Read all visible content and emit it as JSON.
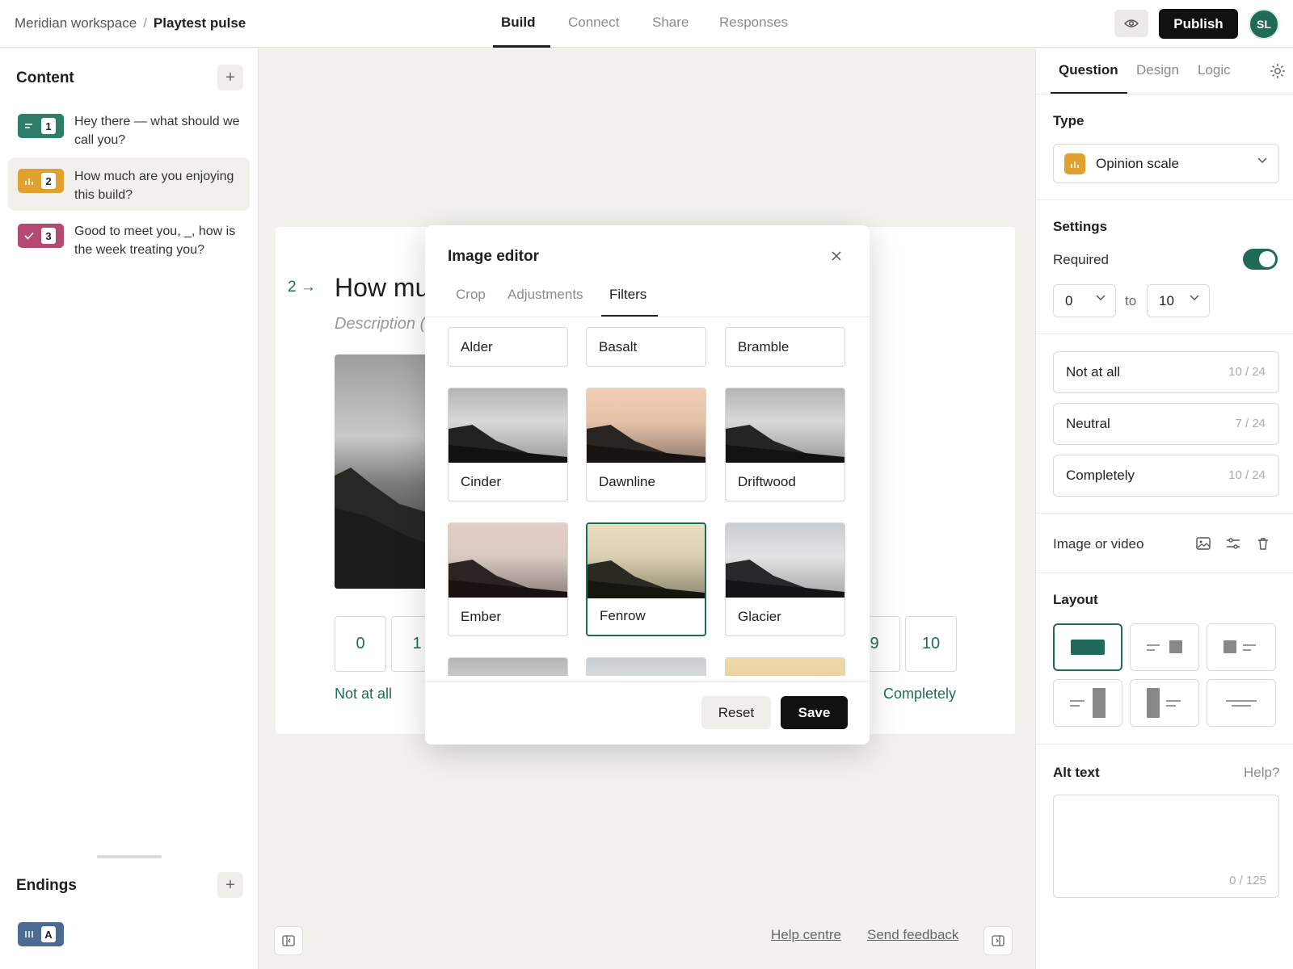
{
  "breadcrumb": {
    "workspace": "Meridian workspace",
    "separator": "/",
    "form": "Playtest pulse"
  },
  "nav_tabs": [
    "Build",
    "Connect",
    "Share",
    "Responses"
  ],
  "header": {
    "publish_label": "Publish",
    "avatar_initials": "SL"
  },
  "sidebar": {
    "content_heading": "Content",
    "questions": [
      {
        "num": "1",
        "text": "Hey there — what should we call you?",
        "color": "#2e7d68",
        "icon": "short-text-icon"
      },
      {
        "num": "2",
        "text": "How much are you enjoying this build?",
        "color": "#e0a12f",
        "icon": "bar-chart-icon"
      },
      {
        "num": "3",
        "text": "Good to meet you, _, how is the week treating you?",
        "color": "#b24a72",
        "icon": "check-icon"
      }
    ],
    "endings_heading": "Endings",
    "ending_badge": "A"
  },
  "canvas": {
    "question_number": "2",
    "question_title": "How mu",
    "description": "Description (",
    "scale_left": [
      "0",
      "1"
    ],
    "scale_right": [
      "9",
      "10"
    ],
    "label_left": "Not at all",
    "label_right": "Completely",
    "footer_links": {
      "help": "Help centre",
      "feedback": "Send feedback"
    }
  },
  "modal": {
    "title": "Image editor",
    "tabs": [
      "Crop",
      "Adjustments",
      "Filters"
    ],
    "filters_plain": [
      "Alder",
      "Basalt",
      "Bramble"
    ],
    "filters": [
      "Cinder",
      "Dawnline",
      "Driftwood",
      "Ember",
      "Fenrow",
      "Glacier"
    ],
    "selected_filter": "Fenrow",
    "reset_label": "Reset",
    "save_label": "Save"
  },
  "right_panel": {
    "tabs": [
      "Question",
      "Design",
      "Logic"
    ],
    "type_heading": "Type",
    "type_value": "Opinion scale",
    "settings_heading": "Settings",
    "required_label": "Required",
    "required_on": true,
    "range_from": "0",
    "range_to_label": "to",
    "range_to": "10",
    "labels": [
      {
        "text": "Not at all",
        "count": "10 / 24"
      },
      {
        "text": "Neutral",
        "count": "7 / 24"
      },
      {
        "text": "Completely",
        "count": "10 / 24"
      }
    ],
    "image_label": "Image or video",
    "layout_heading": "Layout",
    "alt_heading": "Alt text",
    "alt_help": "Help?",
    "alt_count": "0 / 125"
  },
  "colors": {
    "accent": "#1e6b58",
    "primary_button": "#111111"
  }
}
